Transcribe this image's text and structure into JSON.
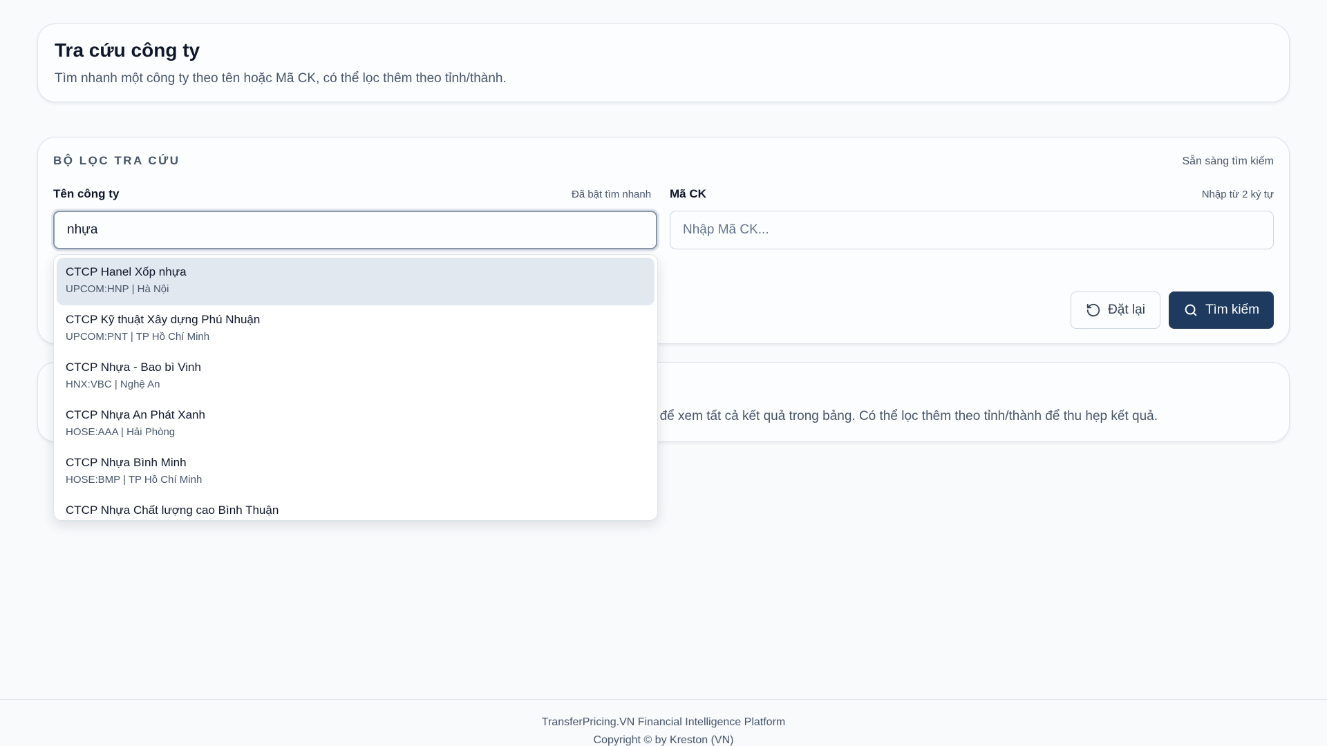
{
  "header": {
    "title": "Tra cứu công ty",
    "subtitle": "Tìm nhanh một công ty theo tên hoặc Mã CK, có thể lọc thêm theo tỉnh/thành."
  },
  "filter": {
    "section_title": "BỘ LỌC TRA CỨU",
    "status": "Sẵn sàng tìm kiếm",
    "company": {
      "label": "Tên công ty",
      "hint": "Đã bật tìm nhanh",
      "value": "nhựa"
    },
    "ticker": {
      "label": "Mã CK",
      "hint": "Nhập từ 2 ký tự",
      "placeholder": "Nhập Mã CK...",
      "value": ""
    },
    "reset_label": "Đặt lại",
    "search_label": "Tìm kiếm"
  },
  "info": {
    "text": "n để xem tất cả kết quả trong bảng. Có thể lọc thêm theo tỉnh/thành để thu hẹp kết quả."
  },
  "suggestions": [
    {
      "name": "CTCP Hanel Xốp nhựa",
      "meta": "UPCOM:HNP | Hà Nội"
    },
    {
      "name": "CTCP Kỹ thuật Xây dựng Phú Nhuận",
      "meta": "UPCOM:PNT | TP Hồ Chí Minh"
    },
    {
      "name": "CTCP Nhựa - Bao bì Vinh",
      "meta": "HNX:VBC | Nghệ An"
    },
    {
      "name": "CTCP Nhựa An Phát Xanh",
      "meta": "HOSE:AAA | Hải Phòng"
    },
    {
      "name": "CTCP Nhựa Bình Minh",
      "meta": "HOSE:BMP | TP Hồ Chí Minh"
    },
    {
      "name": "CTCP Nhựa Chất lượng cao Bình Thuận",
      "meta": ""
    }
  ],
  "footer": {
    "line1": "TransferPricing.VN Financial Intelligence Platform",
    "line2": "Copyright © by Kreston (VN)"
  },
  "colors": {
    "primary": "#1e3a5f",
    "background": "#f8fafc",
    "highlight": "#e2e8f0"
  },
  "icons": {
    "reset": "rotate-ccw-icon",
    "search": "search-icon"
  }
}
